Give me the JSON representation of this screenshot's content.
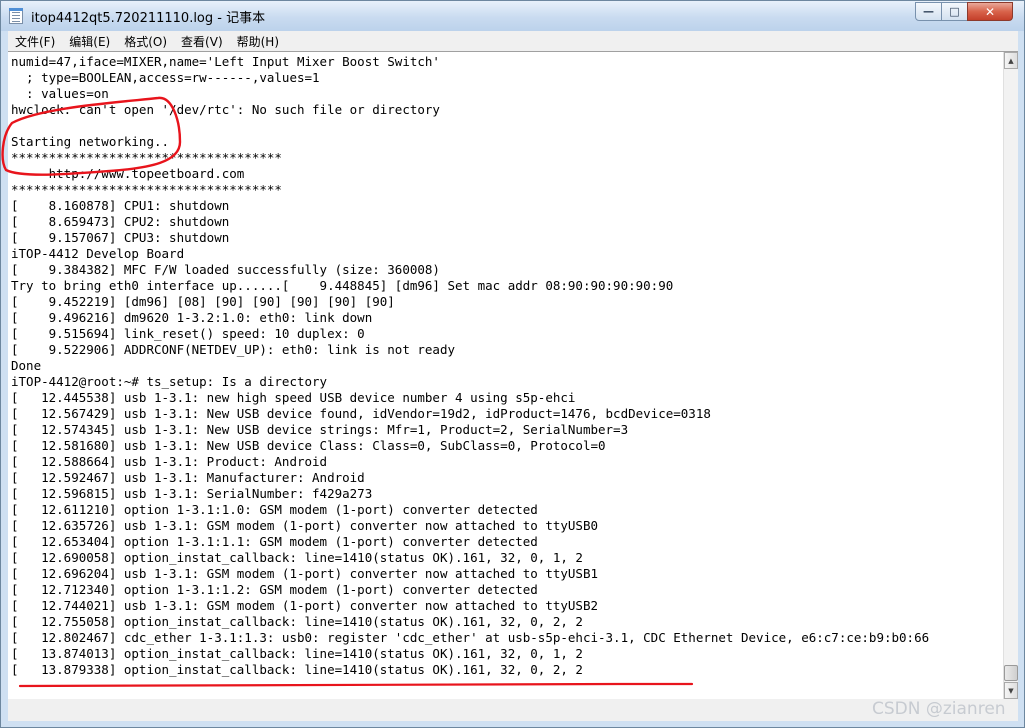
{
  "window": {
    "title": "itop4412qt5.720211110.log - 记事本",
    "controls": {
      "minimize": "—",
      "maximize": "□",
      "close": "✕"
    }
  },
  "menu": [
    "文件(F)",
    "编辑(E)",
    "格式(O)",
    "查看(V)",
    "帮助(H)"
  ],
  "lines": [
    "numid=47,iface=MIXER,name='Left Input Mixer Boost Switch'",
    "  ; type=BOOLEAN,access=rw------,values=1",
    "  : values=on",
    "hwclock: can't open '/dev/rtc': No such file or directory",
    "",
    "Starting networking..",
    "************************************",
    "     http://www.topeetboard.com",
    "************************************",
    "[    8.160878] CPU1: shutdown",
    "[    8.659473] CPU2: shutdown",
    "[    9.157067] CPU3: shutdown",
    "iTOP-4412 Develop Board",
    "[    9.384382] MFC F/W loaded successfully (size: 360008)",
    "Try to bring eth0 interface up......[    9.448845] [dm96] Set mac addr 08:90:90:90:90:90",
    "[    9.452219] [dm96] [08] [90] [90] [90] [90] [90]",
    "[    9.496216] dm9620 1-3.2:1.0: eth0: link down",
    "[    9.515694] link_reset() speed: 10 duplex: 0",
    "[    9.522906] ADDRCONF(NETDEV_UP): eth0: link is not ready",
    "Done",
    "iTOP-4412@root:~# ts_setup: Is a directory",
    "[   12.445538] usb 1-3.1: new high speed USB device number 4 using s5p-ehci",
    "[   12.567429] usb 1-3.1: New USB device found, idVendor=19d2, idProduct=1476, bcdDevice=0318",
    "[   12.574345] usb 1-3.1: New USB device strings: Mfr=1, Product=2, SerialNumber=3",
    "[   12.581680] usb 1-3.1: New USB device Class: Class=0, SubClass=0, Protocol=0",
    "[   12.588664] usb 1-3.1: Product: Android",
    "[   12.592467] usb 1-3.1: Manufacturer: Android",
    "[   12.596815] usb 1-3.1: SerialNumber: f429a273",
    "[   12.611210] option 1-3.1:1.0: GSM modem (1-port) converter detected",
    "[   12.635726] usb 1-3.1: GSM modem (1-port) converter now attached to ttyUSB0",
    "[   12.653404] option 1-3.1:1.1: GSM modem (1-port) converter detected",
    "[   12.690058] option_instat_callback: line=1410(status OK).161, 32, 0, 1, 2",
    "[   12.696204] usb 1-3.1: GSM modem (1-port) converter now attached to ttyUSB1",
    "[   12.712340] option 1-3.1:1.2: GSM modem (1-port) converter detected",
    "[   12.744021] usb 1-3.1: GSM modem (1-port) converter now attached to ttyUSB2",
    "[   12.755058] option_instat_callback: line=1410(status OK).161, 32, 0, 2, 2",
    "[   12.802467] cdc_ether 1-3.1:1.3: usb0: register 'cdc_ether' at usb-s5p-ehci-3.1, CDC Ethernet Device, e6:c7:ce:b9:b0:66",
    "[   13.874013] option_instat_callback: line=1410(status OK).161, 32, 0, 1, 2",
    "[   13.879338] option_instat_callback: line=1410(status OK).161, 32, 0, 2, 2"
  ],
  "scrollbar": {
    "up": "▲",
    "down": "▼",
    "position": 0.97
  },
  "annotation": {
    "color": "#e8141c"
  },
  "watermark": "CSDN @zianren"
}
